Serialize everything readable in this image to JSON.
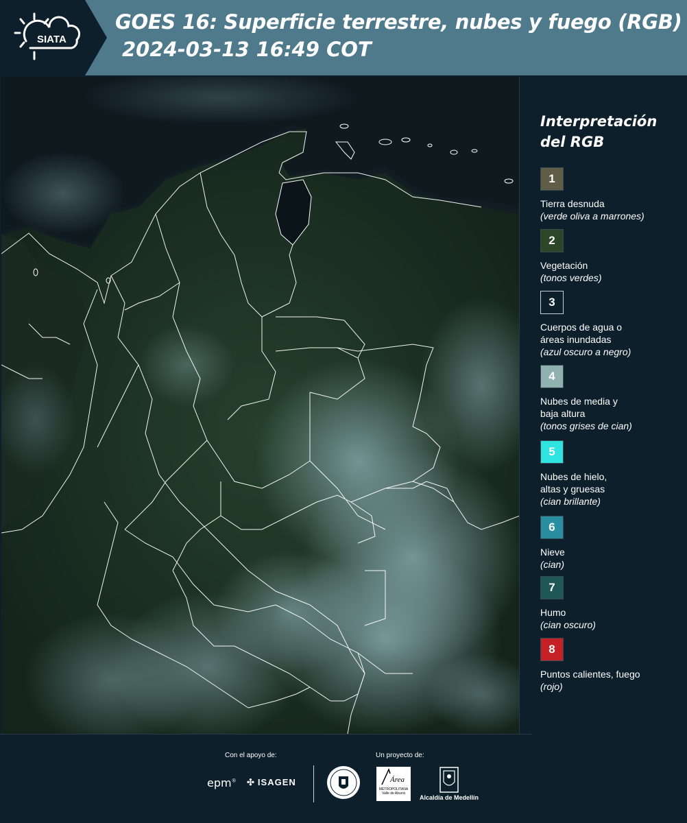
{
  "header": {
    "logo_text": "SIATA",
    "title": "GOES 16: Superficie terrestre, nubes y fuego (RGB)",
    "datetime": "2024-03-13 16:49 COT"
  },
  "map": {
    "land_color": "#1f3327",
    "cloud_color": "#8fb3b8",
    "border_color": "#ffffff"
  },
  "legend": {
    "title": "Interpretación del RGB",
    "items": [
      {
        "number": "1",
        "color": "#5f5d45",
        "name": "Tierra desnuda",
        "desc": "(verde oliva a marrones)"
      },
      {
        "number": "2",
        "color": "#2c4628",
        "name": "Vegetación",
        "desc": "(tonos verdes)"
      },
      {
        "number": "3",
        "color": "#0d1f2b",
        "name": "Cuerpos de agua o\náreas inundadas",
        "desc": "(azul oscuro a negro)"
      },
      {
        "number": "4",
        "color": "#8fb1b0",
        "name": "Nubes de media y\nbaja altura",
        "desc": "(tonos grises de cian)"
      },
      {
        "number": "5",
        "color": "#2ee3e0",
        "name": "Nubes de hielo,\naltas y gruesas",
        "desc": "(cian brillante)"
      },
      {
        "number": "6",
        "color": "#2a8ea3",
        "name": "Nieve",
        "desc": "(cian)"
      },
      {
        "number": "7",
        "color": "#1f5757",
        "name": "Humo",
        "desc": "(cian oscuro)"
      },
      {
        "number": "8",
        "color": "#c42026",
        "name": "Puntos calientes, fuego",
        "desc": "(rojo)"
      }
    ]
  },
  "footer": {
    "support_caption": "Con el apoyo de:",
    "project_caption": "Un proyecto de:",
    "epm": "epm",
    "isagen": "ISAGEN",
    "area_logo_text": "METROPOLITANA Valle de Aburrá",
    "area_logo_word": "Área",
    "alcaldia": "Alcaldía de Medellín"
  }
}
